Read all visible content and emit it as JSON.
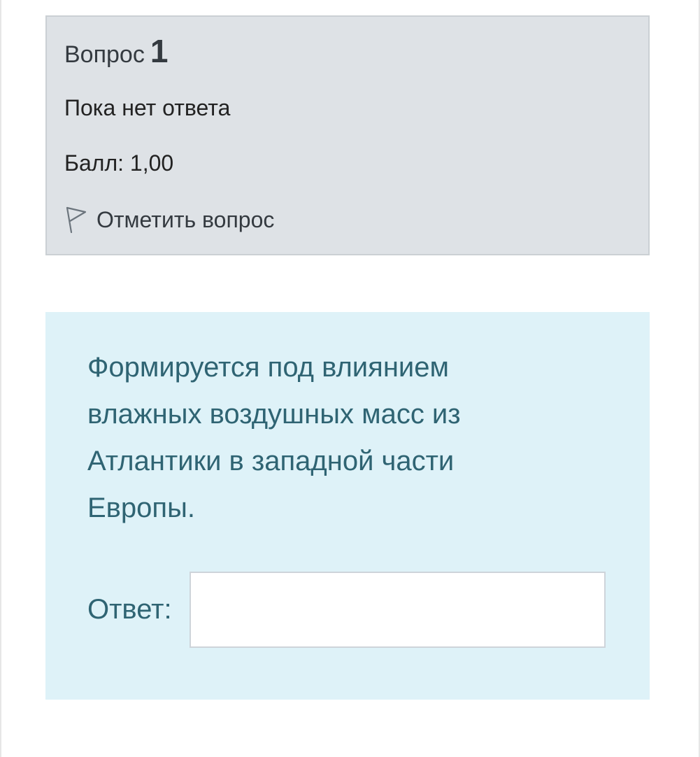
{
  "question_info": {
    "label": "Вопрос",
    "number": "1",
    "state": "Пока нет ответа",
    "grade": "Балл: 1,00",
    "flag_label": "Отметить вопрос",
    "flag_icon": "flag-outline-icon"
  },
  "question": {
    "text": "Формируется под влиянием влажных воздушных масс из Атлантики в западной части Европы.",
    "answer_label": "Ответ:",
    "answer_value": ""
  },
  "colors": {
    "info_background": "#dee2e6",
    "content_background": "#def2f8",
    "question_text": "#2f6473"
  }
}
